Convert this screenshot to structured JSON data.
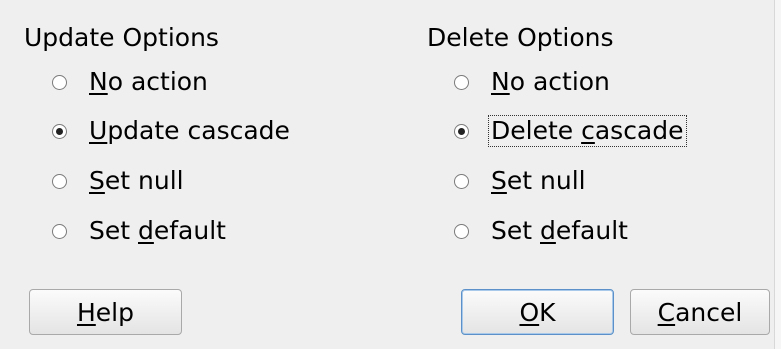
{
  "update_options": {
    "title": "Update Options",
    "options": [
      {
        "pre": "",
        "key": "N",
        "post": "o action",
        "checked": false
      },
      {
        "pre": "",
        "key": "U",
        "post": "pdate cascade",
        "checked": true
      },
      {
        "pre": "",
        "key": "S",
        "post": "et null",
        "checked": false
      },
      {
        "pre": "Set ",
        "key": "d",
        "post": "efault",
        "checked": false
      }
    ]
  },
  "delete_options": {
    "title": "Delete Options",
    "options": [
      {
        "pre": "",
        "key": "N",
        "post": "o action",
        "checked": false
      },
      {
        "pre": "Delete ",
        "key": "c",
        "post": "ascade",
        "checked": true
      },
      {
        "pre": "",
        "key": "S",
        "post": "et null",
        "checked": false
      },
      {
        "pre": "Set ",
        "key": "d",
        "post": "efault",
        "checked": false
      }
    ]
  },
  "buttons": {
    "help": {
      "pre": "",
      "key": "H",
      "post": "elp"
    },
    "ok": {
      "pre": "",
      "key": "O",
      "post": "K"
    },
    "cancel": {
      "pre": "",
      "key": "C",
      "post": "ancel"
    }
  }
}
